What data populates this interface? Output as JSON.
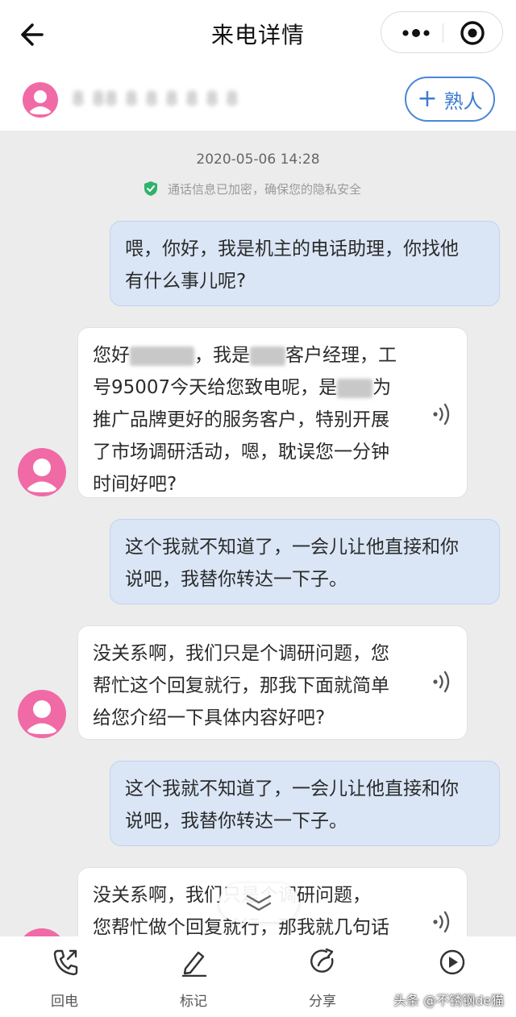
{
  "header": {
    "title": "来电详情",
    "back_icon": "back-arrow-icon",
    "more_icon": "more-dots-icon",
    "close_icon": "target-close-icon"
  },
  "contact": {
    "number": "8 88 8 8 8 8 8 8",
    "add_button_label": "熟人"
  },
  "call": {
    "time": "2020-05-06 14:28",
    "encryption_notice": "通话信息已加密，确保您的隐私安全"
  },
  "messages": [
    {
      "role": "assistant",
      "lines": [
        "喂，你好，我是机主的电话助理，你找他",
        "有什么事儿呢?"
      ]
    },
    {
      "role": "caller",
      "lines": [
        "您好",
        "，我是",
        "客户经理，工",
        "号95007今天给您致电呢，是",
        "为",
        "推广品牌更好的服务客户，特别开展",
        "了市场调研活动，嗯，耽误您一分钟",
        "时间好吧?"
      ]
    },
    {
      "role": "assistant",
      "lines": [
        "这个我就不知道了，一会儿让他直接和你",
        "说吧，我替你转达一下子。"
      ]
    },
    {
      "role": "caller",
      "lines": [
        "没关系啊，我们只是个调研问题，您",
        "帮忙这个回复就行，那我下面就简单",
        "给您介绍一下具体内容好吧?"
      ]
    },
    {
      "role": "assistant",
      "lines": [
        "这个我就不知道了，一会儿让他直接和你",
        "说吧，我替你转达一下子。"
      ]
    },
    {
      "role": "caller",
      "lines": [
        "没关系啊，我们只是个调研问题，",
        "您帮忙做个回复就行，那我就几句话"
      ]
    }
  ],
  "toolbar": {
    "items": [
      {
        "label": "回电",
        "icon": "phone-callback-icon"
      },
      {
        "label": "标记",
        "icon": "pencil-icon"
      },
      {
        "label": "分享",
        "icon": "share-icon"
      },
      {
        "label": "",
        "icon": "play-icon"
      }
    ]
  },
  "watermark": "头条 @不锈钢de猫",
  "colors": {
    "accent": "#3e7bd0",
    "assistant_bubble": "#dae6f6",
    "avatar_pink": "#f06aa6",
    "shield_green": "#2fb36b"
  }
}
